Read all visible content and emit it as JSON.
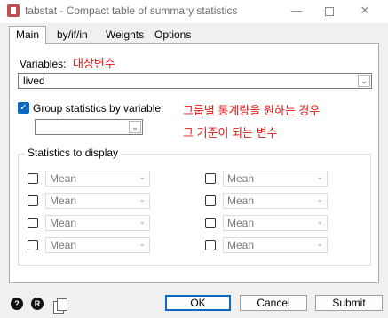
{
  "window": {
    "title": "tabstat - Compact table of summary statistics",
    "minimize_glyph": "—",
    "close_glyph": "✕"
  },
  "tabs": [
    {
      "label": "Main",
      "active": true
    },
    {
      "label": "by/if/in",
      "active": false
    },
    {
      "label": "Weights",
      "active": false
    },
    {
      "label": "Options",
      "active": false
    }
  ],
  "main": {
    "variables_label": "Variables:",
    "variables_annotation": "대상변수",
    "variables_value": "lived",
    "group_checkbox_label": "Group statistics by variable:",
    "group_checked": true,
    "group_annotation_line1": "그룹별 통계량을 원하는 경우",
    "group_annotation_line2": "그 기준이 되는 변수",
    "group_variable_value": "",
    "statistics_legend": "Statistics to display",
    "statistics": [
      {
        "checked": false,
        "value": "Mean"
      },
      {
        "checked": false,
        "value": "Mean"
      },
      {
        "checked": false,
        "value": "Mean"
      },
      {
        "checked": false,
        "value": "Mean"
      },
      {
        "checked": false,
        "value": "Mean"
      },
      {
        "checked": false,
        "value": "Mean"
      },
      {
        "checked": false,
        "value": "Mean"
      },
      {
        "checked": false,
        "value": "Mean"
      }
    ]
  },
  "footer": {
    "help_glyph": "?",
    "reset_glyph": "R",
    "ok_label": "OK",
    "cancel_label": "Cancel",
    "submit_label": "Submit"
  },
  "colors": {
    "annotation": "#e31a1a",
    "accent": "#0c67c0"
  }
}
